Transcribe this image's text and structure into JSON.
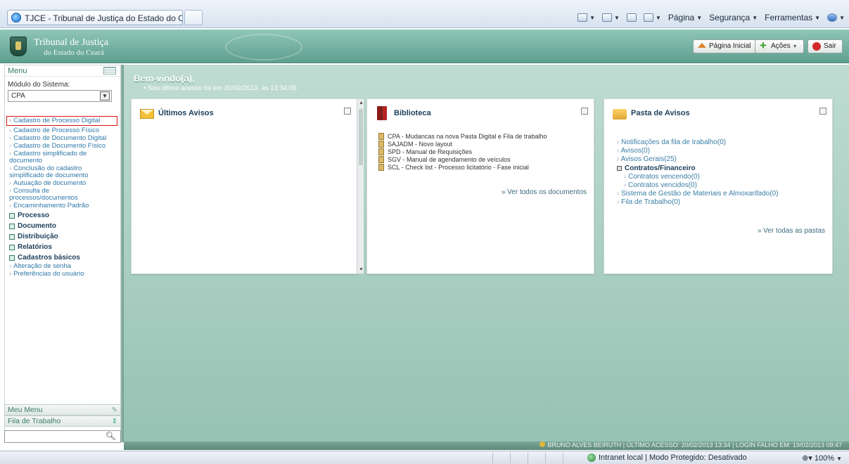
{
  "browser": {
    "tab_title": "TJCE - Tribunal de Justiça do Estado do Ceará",
    "menus": [
      {
        "label": "Página"
      },
      {
        "label": "Segurança"
      },
      {
        "label": "Ferramentas"
      }
    ]
  },
  "header": {
    "logo_line1": "Tribunal de Justiça",
    "logo_line2": "do Estado do Ceará",
    "home_label": "Página Inicial",
    "actions_label": "Ações",
    "exit_label": "Sair"
  },
  "sidebar": {
    "menu_title": "Menu",
    "module_label": "Módulo do Sistema:",
    "module_value": "CPA",
    "items": [
      "Cadastro de Processo Digital",
      "Cadastro de Processo Físico",
      "Cadastro de Documento Digital",
      "Cadastro de Documento Físico",
      "Cadastro simplificado de documento",
      "Conclusão do cadastro simplificado de documento",
      "Autuação de documento",
      "Consulta de processos/documentos",
      "Encaminhamento Padrão"
    ],
    "sections": [
      "Processo",
      "Documento",
      "Distribuição",
      "Relatórios",
      "Cadastros básicos"
    ],
    "extra_items": [
      "Alteração de senha",
      "Preferências do usuário"
    ],
    "my_menu": "Meu Menu",
    "work_queue": "Fila de Trabalho"
  },
  "main": {
    "welcome_title": "Bem-vindo(a),",
    "welcome_sub": "Seu último acesso foi em 20/02/2013, às 13:34:06.",
    "panels": {
      "avisos": {
        "title": "Últimos Avisos"
      },
      "biblioteca": {
        "title": "Biblioteca",
        "docs": [
          "CPA - Mudancas na nova Pasta Digital e Fila de trabalho",
          "SAJADM - Novo layout",
          "SPD - Manual de Requisições",
          "SGV - Manual de agendamento de veículos",
          "SCL - Check list - Processo licitatório - Fase inicial"
        ],
        "see_all": "» Ver todos os documentos"
      },
      "pasta": {
        "title": "Pasta de Avisos",
        "items": [
          "Notificações da fila de trabalho(0)",
          "Avisos(0)",
          "Avisos Gerais(25)"
        ],
        "group_title": "Contratos/Financeiro",
        "group_items": [
          "Contratos vencendo(0)",
          "Contratos vencidos(0)"
        ],
        "more_items": [
          "Sistema de Gestão de Materiais e Almoxarifado(0)",
          "Fila de Trabalho(0)"
        ],
        "see_all": "» Ver todas as pastas"
      }
    }
  },
  "footer": {
    "text": "BRUNO ALVES BEIRUTH   |   ÚLTIMO ACESSO: 20/02/2013 13:34   |   LOGIN FALHO EM: 19/02/2013 09:47"
  },
  "status": {
    "zone": "Intranet local | Modo Protegido: Desativado",
    "zoom": "100%"
  }
}
